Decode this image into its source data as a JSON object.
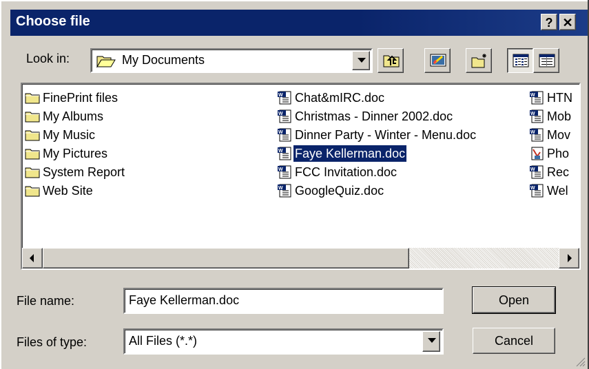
{
  "dialog": {
    "title": "Choose file",
    "help_label": "?",
    "close_label": "✕"
  },
  "look_in": {
    "label": "Look in:",
    "value": "My Documents"
  },
  "toolbar": {
    "up_icon": "up-one-level-icon",
    "desktop_icon": "desktop-icon",
    "new_folder_icon": "new-folder-icon",
    "list_icon": "list-view-icon",
    "details_icon": "details-view-icon"
  },
  "files": {
    "col1": [
      {
        "name": "FinePrint files",
        "icon": "folder-icon"
      },
      {
        "name": "My Albums",
        "icon": "folder-icon"
      },
      {
        "name": "My Music",
        "icon": "folder-icon"
      },
      {
        "name": "My Pictures",
        "icon": "folder-icon"
      },
      {
        "name": "System Report",
        "icon": "folder-icon"
      },
      {
        "name": "Web Site",
        "icon": "folder-icon"
      }
    ],
    "col2": [
      {
        "name": "Chat&mIRC.doc",
        "icon": "word-doc-icon"
      },
      {
        "name": "Christmas - Dinner 2002.doc",
        "icon": "word-doc-icon"
      },
      {
        "name": "Dinner Party - Winter - Menu.doc",
        "icon": "word-doc-icon"
      },
      {
        "name": "Faye Kellerman.doc",
        "icon": "word-doc-icon",
        "selected": true
      },
      {
        "name": "FCC Invitation.doc",
        "icon": "word-doc-icon"
      },
      {
        "name": "GoogleQuiz.doc",
        "icon": "word-doc-icon"
      }
    ],
    "col3": [
      {
        "name": "HTN",
        "icon": "word-doc-icon"
      },
      {
        "name": "Mob",
        "icon": "word-doc-icon"
      },
      {
        "name": "Mov",
        "icon": "word-doc-icon"
      },
      {
        "name": "Pho",
        "icon": "image-file-icon"
      },
      {
        "name": "Rec",
        "icon": "word-doc-icon"
      },
      {
        "name": "Wel",
        "icon": "word-doc-icon"
      }
    ]
  },
  "file_name": {
    "label": "File name:",
    "value": "Faye Kellerman.doc"
  },
  "file_type": {
    "label": "Files of type:",
    "value": "All Files (*.*)"
  },
  "buttons": {
    "open": "Open",
    "cancel": "Cancel"
  },
  "colors": {
    "title_bar": "#0a246a",
    "face": "#d4d0c8",
    "selection": "#0a246a"
  }
}
